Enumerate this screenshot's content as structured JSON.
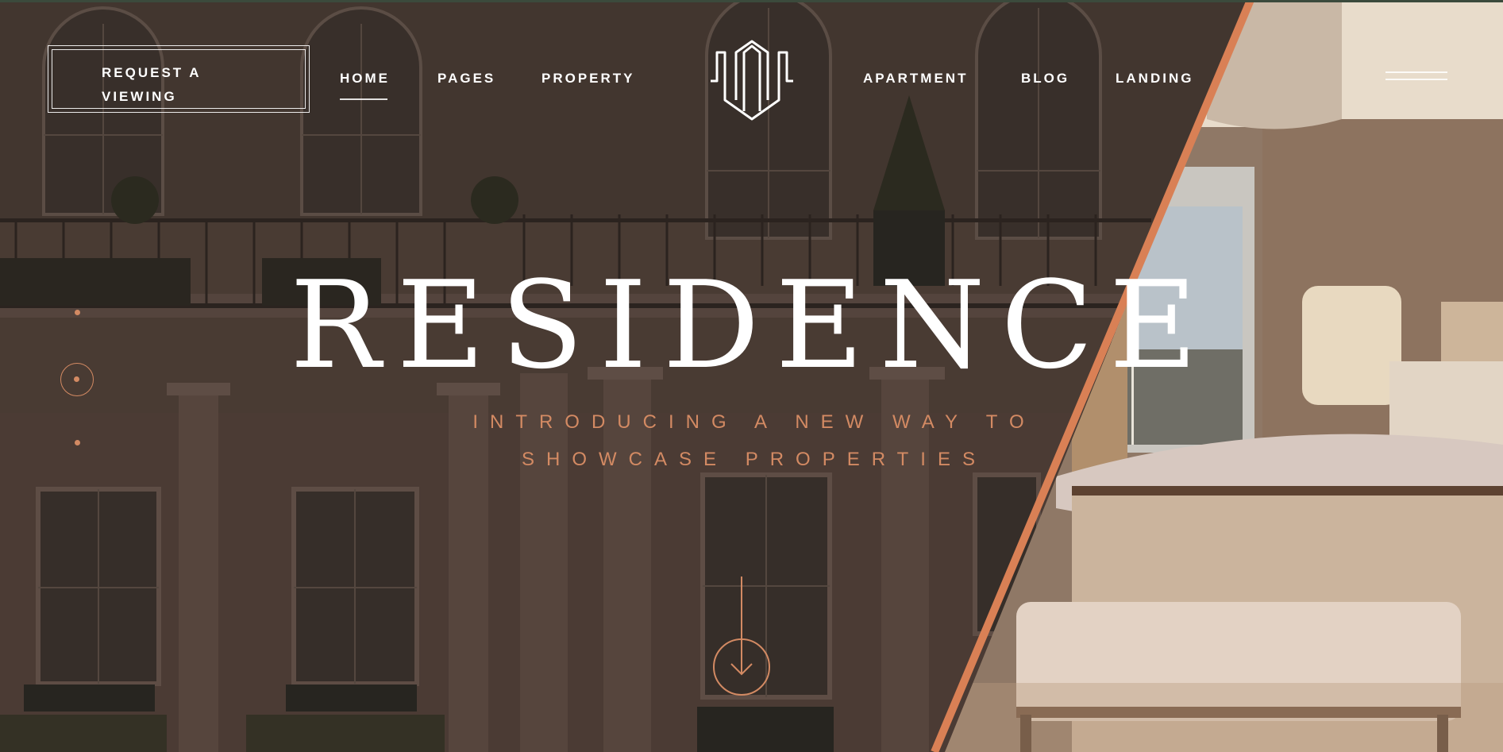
{
  "nav": {
    "cta": "REQUEST A VIEWING",
    "left_links": [
      "HOME",
      "PAGES",
      "PROPERTY"
    ],
    "right_links": [
      "APARTMENT",
      "BLOG",
      "LANDING"
    ],
    "active": "HOME"
  },
  "hero": {
    "title": "RESIDENCE",
    "subtitle": "INTRODUCING A NEW WAY TO SHOWCASE PROPERTIES"
  },
  "slider": {
    "count": 3,
    "active_index": 1
  },
  "colors": {
    "accent": "#d38a63",
    "text": "#ffffff",
    "top_bar": "#3b4a3c"
  },
  "icons": [
    "residence-logo-icon",
    "menu-icon",
    "scroll-down-arrow-icon"
  ]
}
